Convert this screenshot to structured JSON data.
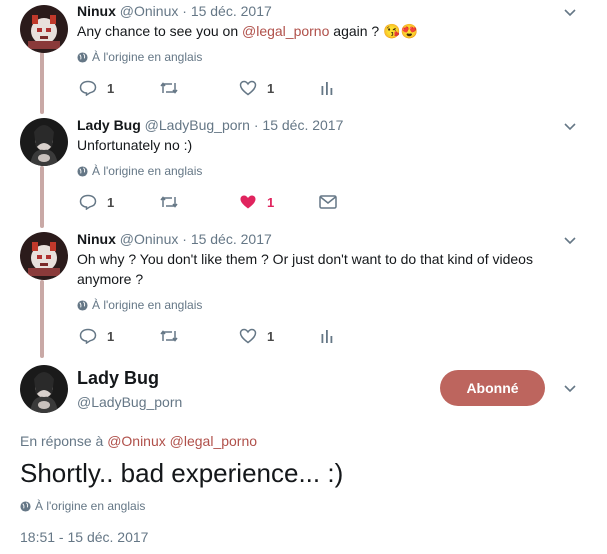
{
  "colors": {
    "accent": "#bd655e",
    "mention": "#b0504a",
    "muted": "#657786",
    "like_active": "#e0245e",
    "thread_line": "#c9a9a6"
  },
  "replies": [
    {
      "name": "Ninux",
      "handle": "@Oninux",
      "date": "15 déc. 2017",
      "text_before": "Any chance to see you on ",
      "mention": "@legal_porno",
      "text_after": " again ?",
      "emoji": "😘😍",
      "translate": "À l'origine en anglais",
      "reply_count": "1",
      "like_count": "1",
      "liked": false,
      "last_action_icon": "analytics-icon"
    },
    {
      "name": "Lady Bug",
      "handle": "@LadyBug_porn",
      "date": "15 déc. 2017",
      "text": "Unfortunately no :)",
      "translate": "À l'origine en anglais",
      "reply_count": "1",
      "like_count": "1",
      "liked": true,
      "last_action_icon": "message-icon"
    },
    {
      "name": "Ninux",
      "handle": "@Oninux",
      "date": "15 déc. 2017",
      "text_line1": "Oh why ? You don't like them ? Or just don't want to do that kind of videos",
      "text_line2": "anymore ?",
      "translate": "À l'origine en anglais",
      "reply_count": "1",
      "like_count": "1",
      "liked": false,
      "last_action_icon": "analytics-icon"
    }
  ],
  "main": {
    "name": "Lady Bug",
    "handle": "@LadyBug_porn",
    "follow_label": "Abonné",
    "reply_prefix": "En réponse à",
    "reply_mention1": "@Oninux",
    "reply_mention2": "@legal_porno",
    "text": "Shortly.. bad experience... :)",
    "translate": "À l'origine en anglais",
    "timestamp": "18:51 - 15 déc. 2017"
  }
}
